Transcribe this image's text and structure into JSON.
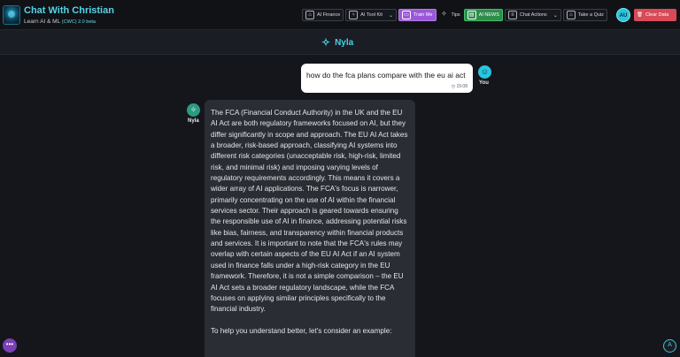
{
  "app": {
    "title": "Chat With Christian",
    "subtitle": "Learn AI & ML",
    "version": "(CWC) 2.0 beta"
  },
  "toolbar": {
    "items": [
      {
        "label": "AI Finance",
        "icon": "bank-icon"
      },
      {
        "label": "AI Tool Kit",
        "icon": "bulb-icon",
        "chevron": true
      },
      {
        "label": "Train Me",
        "icon": "train-icon",
        "active": true
      },
      {
        "label": "Tips",
        "icon": "sparkle-icon"
      },
      {
        "label": "AI NEWS",
        "icon": "news-icon",
        "highlight": true
      },
      {
        "label": "Chat Actions",
        "icon": "list-icon",
        "chevron": true
      },
      {
        "label": "Take a Quiz",
        "icon": "graduation-cap-icon"
      }
    ],
    "avatar_initials": "AU",
    "clear_label": "Clear Data"
  },
  "chat_header": {
    "name": "Nyla"
  },
  "messages": {
    "user": {
      "text": "how do the fca plans compare with the eu ai act",
      "time": "15:08",
      "sender": "You"
    },
    "bot": {
      "sender": "Nyla",
      "paragraphs": [
        "The FCA (Financial Conduct Authority) in the UK and the EU AI Act are both regulatory frameworks focused on AI, but they differ significantly in scope and approach.  The EU AI Act takes a broader, risk-based approach, classifying AI systems into different risk categories (unacceptable risk, high-risk, limited risk, and minimal risk) and imposing varying levels of regulatory requirements accordingly. This means it covers a wider array of AI applications.  The FCA's focus is narrower, primarily concentrating on the use of AI within the financial services sector.  Their approach is geared towards ensuring the responsible use of AI in finance, addressing potential risks like bias, fairness, and transparency within financial products and services.  It is important to note that the FCA's rules may overlap with certain aspects of the EU AI Act if an AI system used in finance falls under a high-risk category in the EU framework.  Therefore, it is not a simple comparison – the EU AI Act sets a broader regulatory landscape, while the FCA focuses on applying similar principles specifically to the financial industry.",
        "To help you understand better, let's consider an example:"
      ]
    }
  },
  "colors": {
    "accent": "#45d2e6",
    "train_active": "#9b57d9",
    "news_active": "#2e8d4c",
    "danger": "#d84a57",
    "background": "#14161b",
    "bot_bubble": "#2a2d33"
  }
}
